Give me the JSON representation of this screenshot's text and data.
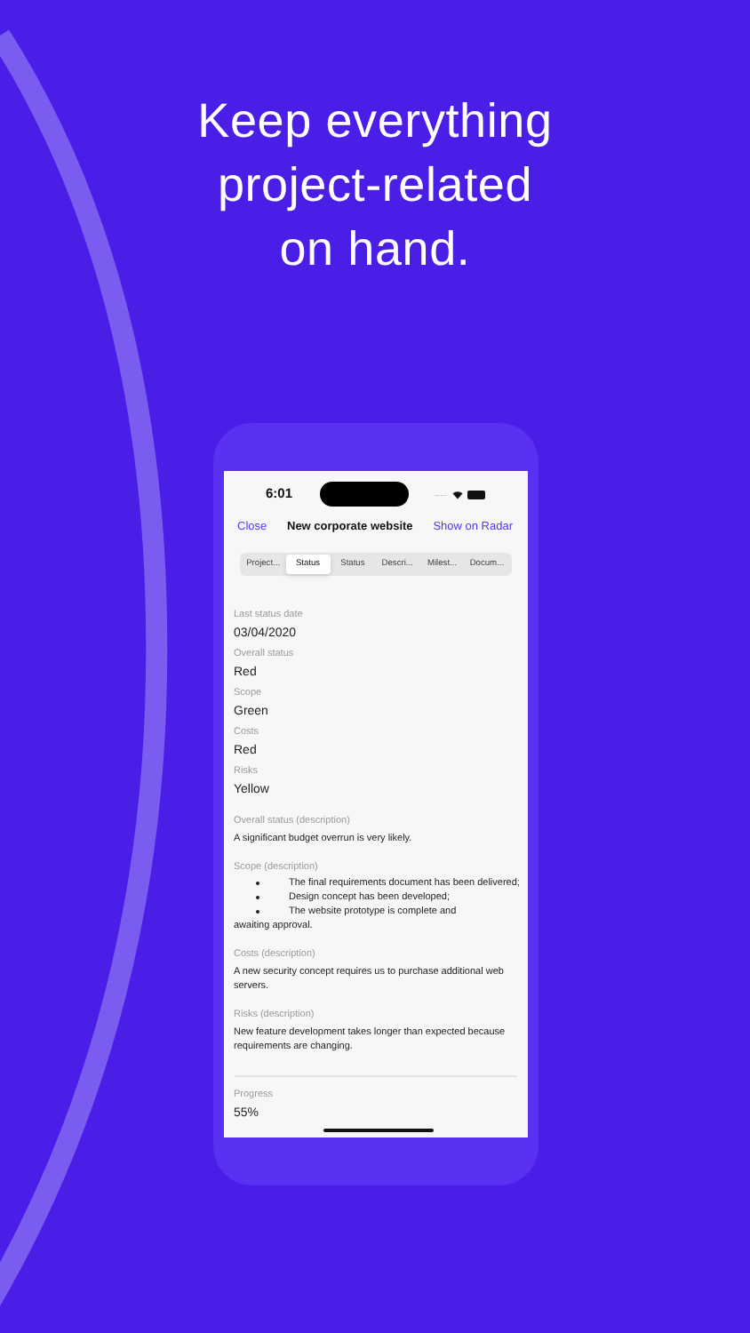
{
  "headline": [
    "Keep everything",
    "project-related",
    "on hand."
  ],
  "status_bar": {
    "time": "6:01",
    "signal": "....."
  },
  "nav": {
    "left": "Close",
    "title": "New corporate website",
    "right": "Show on Radar"
  },
  "tabs": [
    {
      "label": "Project...",
      "selected": false
    },
    {
      "label": "Status",
      "selected": true
    },
    {
      "label": "Status",
      "selected": false
    },
    {
      "label": "Descri...",
      "selected": false
    },
    {
      "label": "Milest...",
      "selected": false
    },
    {
      "label": "Docum...",
      "selected": false
    }
  ],
  "fields": [
    {
      "kind": "value",
      "label": "Last status date",
      "value": "03/04/2020"
    },
    {
      "kind": "value",
      "label": "Overall status",
      "value": "Red"
    },
    {
      "kind": "value",
      "label": "Scope",
      "value": "Green"
    },
    {
      "kind": "value",
      "label": "Costs",
      "value": "Red"
    },
    {
      "kind": "value",
      "label": "Risks",
      "value": "Yellow"
    },
    {
      "kind": "description",
      "label": "Overall status (description)",
      "value": "A significant budget overrun is very likely."
    },
    {
      "kind": "bullets",
      "label": "Scope (description)",
      "items": [
        "The final requirements document has been delivered;",
        "Design concept has been developed;",
        "The website prototype is complete and"
      ],
      "tail": "awaiting approval."
    },
    {
      "kind": "description",
      "label": "Costs (description)",
      "value": "A new security concept requires us to purchase additional web servers."
    },
    {
      "kind": "description",
      "label": "Risks (description)",
      "value": "New feature development takes longer than expected because requirements are changing."
    },
    {
      "kind": "divider"
    },
    {
      "kind": "value",
      "label": "Progress",
      "value": "55%"
    }
  ]
}
